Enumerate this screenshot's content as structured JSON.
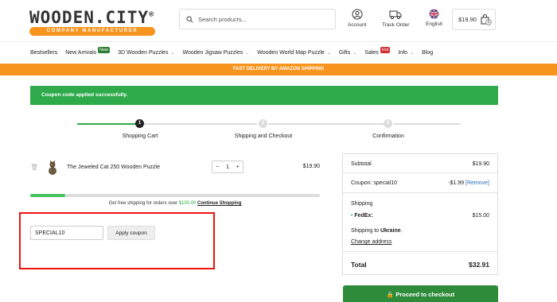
{
  "header": {
    "logo_text": "WOODEN.CITY",
    "logo_reg": "®",
    "logo_sub": "COMPANY MANUFACTURER",
    "search_placeholder": "Search products...",
    "account_label": "Account",
    "track_label": "Track Order",
    "language_label": "English",
    "cart_total": "$19.90",
    "cart_count": "1"
  },
  "nav": {
    "items": [
      {
        "label": "Bestsellers"
      },
      {
        "label": "New Arrivals",
        "badge": "New",
        "badge_color": "#2e7d32"
      },
      {
        "label": "3D Wooden Puzzles",
        "dropdown": true
      },
      {
        "label": "Wooden Jigsaw Puzzles",
        "dropdown": true
      },
      {
        "label": "Wooden World Map Puzzle",
        "dropdown": true
      },
      {
        "label": "Gifts",
        "dropdown": true
      },
      {
        "label": "Sales",
        "badge": "Hot",
        "badge_color": "#d32f2f"
      },
      {
        "label": "Info",
        "dropdown": true
      },
      {
        "label": "Blog"
      }
    ]
  },
  "strip_text": "FAST DELIVERY BY AMAZON SHIPPING",
  "notice_text": "Coupon code applied successfully.",
  "steps": [
    {
      "num": "1",
      "label": "Shopping Cart",
      "active": true
    },
    {
      "num": "2",
      "label": "Shipping and Checkout",
      "active": false
    },
    {
      "num": "3",
      "label": "Confirmation",
      "active": false
    }
  ],
  "cart": {
    "item_name": "The Jeweled Cat 250 Wooden Puzzle",
    "qty_minus": "−",
    "qty": "1",
    "qty_plus": "+",
    "price": "$19.90",
    "progress_fraction": 0.12,
    "ship_msg_pre": "Get free shipping for orders over",
    "ship_msg_amount": "$100.00",
    "ship_msg_link": "Continue Shopping"
  },
  "coupon": {
    "value": "SPECIAL10",
    "button_label": "Apply coupon"
  },
  "totals": {
    "subtotal_label": "Subtotal",
    "subtotal_value": "$19.90",
    "coupon_label": "Coupon: special10",
    "coupon_value": "-$1.99",
    "coupon_remove": "[Remove]",
    "shipping_label": "Shipping",
    "fedex_label": "FedEx:",
    "fedex_value": "$15.00",
    "shipping_to_pre": "Shipping to",
    "shipping_to_country": "Ukraine",
    "change_address": "Change address",
    "total_label": "Total",
    "total_value": "$32.91",
    "checkout_label": "Proceed to checkout"
  },
  "colors": {
    "orange": "#f7941d",
    "green": "#2eaa4b",
    "checkout_green": "#2e8b3a",
    "link_blue": "#2a6ebb"
  }
}
